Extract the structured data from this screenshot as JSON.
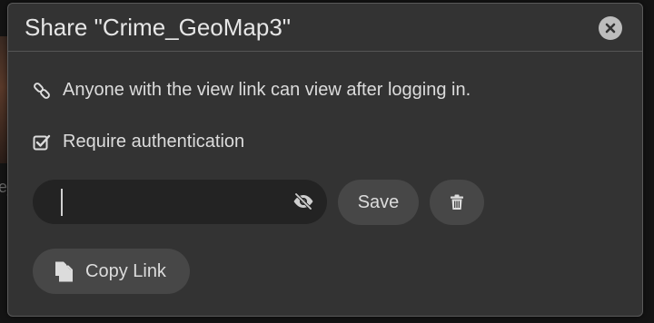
{
  "dialog": {
    "title": "Share \"Crime_GeoMap3\"",
    "close_icon": "close-icon"
  },
  "background": {
    "partial_label": "e_G"
  },
  "info": {
    "link_icon": "link-icon",
    "text": "Anyone with the view link can view after logging in."
  },
  "auth": {
    "checkbox_icon": "checkbox-checked-icon",
    "label": "Require authentication",
    "checked": true
  },
  "password": {
    "value": "",
    "visibility_icon": "eye-slash-icon"
  },
  "buttons": {
    "save_label": "Save",
    "delete_icon": "trash-icon",
    "copy_label": "Copy Link",
    "copy_icon": "copy-icon"
  },
  "colors": {
    "modal_bg": "#333333",
    "field_bg": "#232323",
    "button_bg": "#474747",
    "text": "#dcdcdc"
  }
}
